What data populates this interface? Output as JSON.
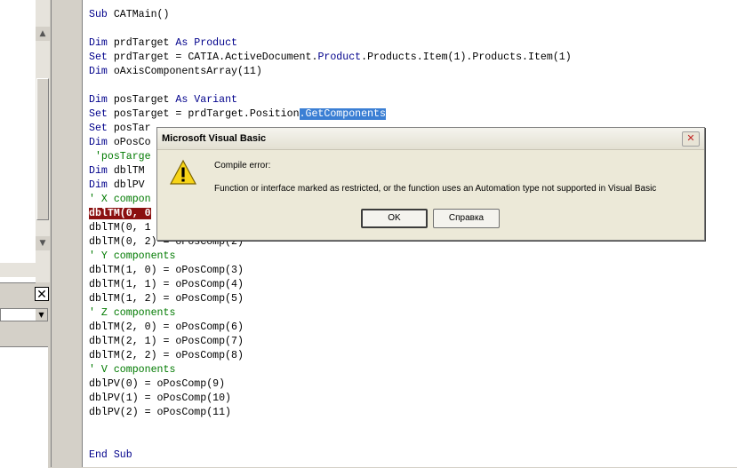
{
  "code_lines": [
    "Sub CATMain()",
    "",
    "Dim prdTarget As Product",
    "Set prdTarget = CATIA.ActiveDocument.Product.Products.Item(1).Products.Item(1)",
    "Dim oAxisComponentsArray(11)",
    "",
    "Dim posTarget As Variant",
    "Set posTarget = prdTarget.Position.GetComponents",
    "Set posTar",
    "Dim oPosCo",
    " 'posTarge",
    "Dim dblTM",
    "Dim dblPV",
    "' X compon",
    "dblTM(0, 0",
    "dblTM(0, 1",
    "dblTM(0, 2) = oPosComp(2)",
    "' Y components",
    "dblTM(1, 0) = oPosComp(3)",
    "dblTM(1, 1) = oPosComp(4)",
    "dblTM(1, 2) = oPosComp(5)",
    "' Z components",
    "dblTM(2, 0) = oPosComp(6)",
    "dblTM(2, 1) = oPosComp(7)",
    "dblTM(2, 2) = oPosComp(8)",
    "' V components",
    "dblPV(0) = oPosComp(9)",
    "dblPV(1) = oPosComp(10)",
    "dblPV(2) = oPosComp(11)",
    "",
    "",
    "End Sub"
  ],
  "highlight": {
    "line_index": 7,
    "text": ".GetComponents"
  },
  "breakpoint_line_index": 14,
  "left_panel": {
    "close_glyph": "✕"
  },
  "dialog": {
    "title": "Microsoft Visual Basic",
    "close_glyph": "✕",
    "icon": "warning-icon",
    "heading": "Compile error:",
    "message": "Function or interface marked as restricted, or the function uses an Automation type not supported in Visual Basic",
    "ok_label": "OK",
    "help_label": "Справка"
  },
  "colors": {
    "keyword": "#00008b",
    "comment": "#007a00",
    "breakpoint": "#8b1010",
    "selection": "#3b7fd4"
  }
}
